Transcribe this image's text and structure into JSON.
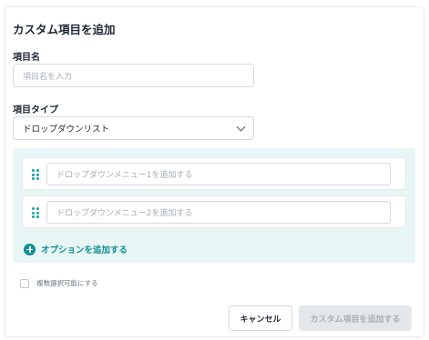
{
  "dialog": {
    "title": "カスタム項目を追加",
    "name_label": "項目名",
    "name_placeholder": "項目名を入力",
    "type_label": "項目タイプ",
    "type_value": "ドロップダウンリスト",
    "options": [
      {
        "placeholder": "ドロップダウンメニュー1を追加する"
      },
      {
        "placeholder": "ドロップダウンメニュー2を追加する"
      }
    ],
    "add_option_label": "オプションを追加する",
    "multi_select_label": "複数選択可能にする",
    "cancel_label": "キャンセル",
    "submit_label": "カスタム項目を追加する"
  },
  "colors": {
    "accent": "#0f8f94",
    "panel_bg": "#e9f6f6",
    "disabled_button_bg": "#e4e7ea"
  }
}
